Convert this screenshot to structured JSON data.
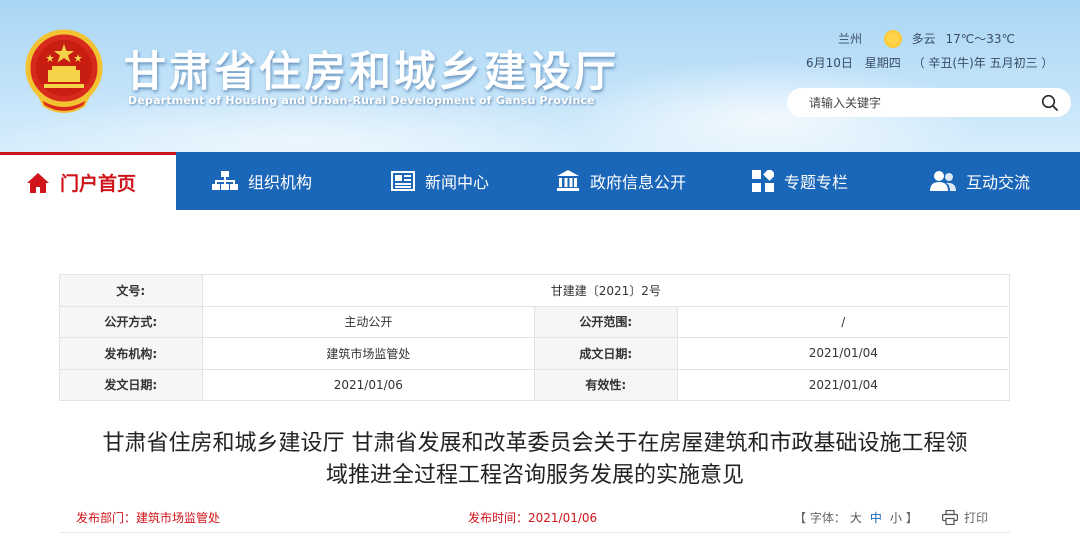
{
  "site": {
    "title": "甘肃省住房和城乡建设厅",
    "subtitle": "Department of Housing and Urban-Rural Development of Gansu Province"
  },
  "weather": {
    "city": "兰州",
    "condition": "多云",
    "temperature": "17℃～33℃",
    "date": "6月10日",
    "weekday": "星期四",
    "lunar": "（ 辛丑(牛)年 五月初三 ）"
  },
  "search": {
    "placeholder": "请输入关键字"
  },
  "nav": {
    "home": "门户首页",
    "org": "组织机构",
    "news": "新闻中心",
    "gov_info": "政府信息公开",
    "topics": "专题专栏",
    "interact": "互动交流"
  },
  "info": {
    "doc_no_label": "文号:",
    "doc_no": "甘建建〔2021〕2号",
    "open_mode_label": "公开方式:",
    "open_mode": "主动公开",
    "open_scope_label": "公开范围:",
    "open_scope": "/",
    "publisher_label": "发布机构:",
    "publisher": "建筑市场监管处",
    "created_label": "成文日期:",
    "created": "2021/01/04",
    "issued_label": "发文日期:",
    "issued": "2021/01/06",
    "validity_label": "有效性:",
    "validity": "2021/01/04"
  },
  "article": {
    "title_line1": "甘肃省住房和城乡建设厅 甘肃省发展和改革委员会关于在房屋建筑和市政基础设施工程领",
    "title_line2": "域推进全过程工程咨询服务发展的实施意见",
    "dept": "发布部门：建筑市场监管处",
    "pub_time": "发布时间：2021/01/06",
    "font_label_open": "【 字体：",
    "font_large": "大",
    "font_medium": "中",
    "font_small": "小",
    "font_label_close": "】",
    "print": "打印"
  },
  "colors": {
    "nav_bg": "#1a66b8",
    "accent_red": "#d0141b"
  }
}
